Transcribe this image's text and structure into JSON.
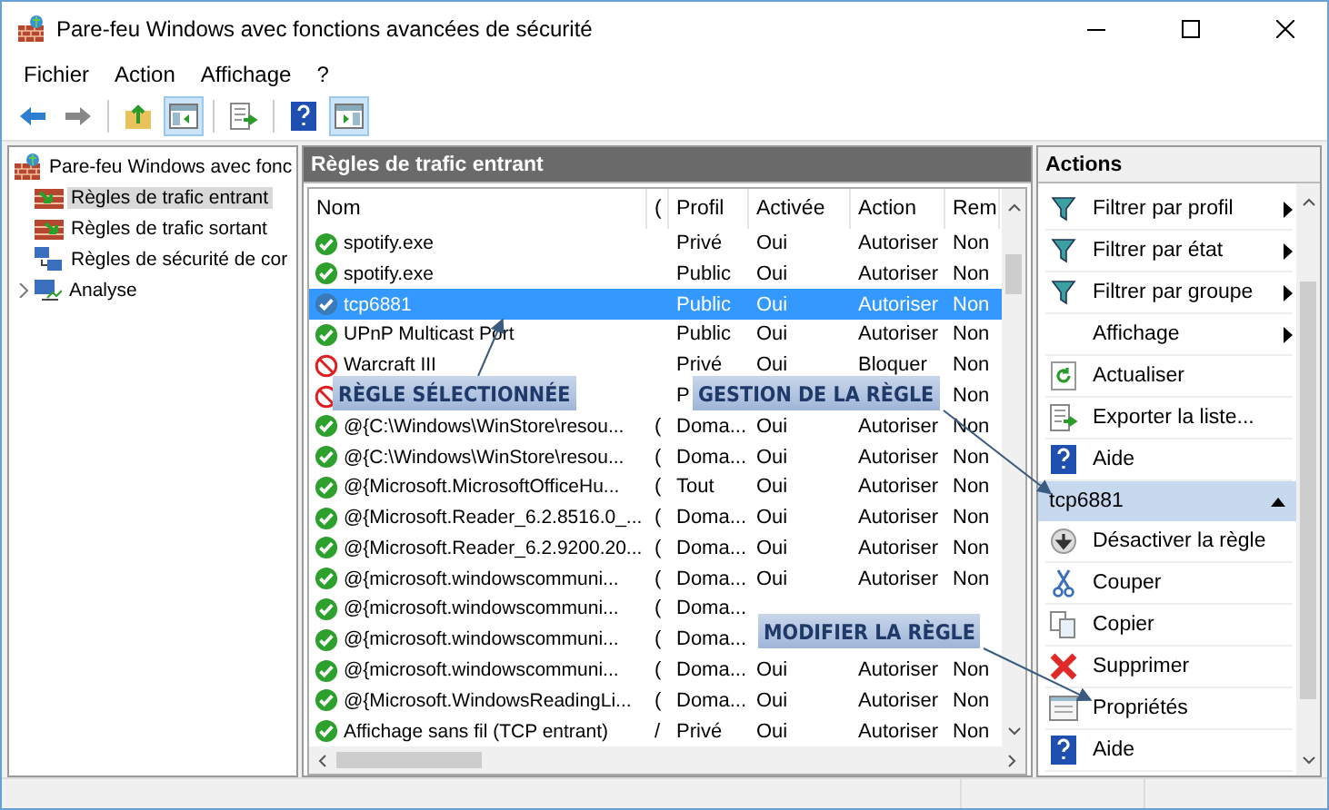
{
  "window": {
    "title": "Pare-feu Windows avec fonctions avancées de sécurité"
  },
  "menu": [
    "Fichier",
    "Action",
    "Affichage",
    "?"
  ],
  "toolbar": [
    {
      "kind": "back",
      "pressed": false
    },
    {
      "kind": "forward",
      "pressed": false
    },
    {
      "kind": "up",
      "pressed": false
    },
    {
      "kind": "tree",
      "pressed": true
    },
    {
      "kind": "export",
      "pressed": false
    },
    {
      "kind": "help",
      "pressed": false
    },
    {
      "kind": "actionpane",
      "pressed": true
    }
  ],
  "tree": {
    "label": "Pare-feu Windows avec fonc",
    "children": [
      {
        "label": "Règles de trafic entrant",
        "kind": "inbound",
        "selected": true
      },
      {
        "label": "Règles de trafic sortant",
        "kind": "outbound",
        "selected": false
      },
      {
        "label": "Règles de sécurité de cor",
        "kind": "security",
        "selected": false
      },
      {
        "label": "Analyse",
        "kind": "monitor",
        "selected": false,
        "expanded": false
      }
    ]
  },
  "table": {
    "title": "Règles de trafic entrant",
    "columns": [
      "Nom",
      "(",
      "Profil",
      "Activée",
      "Action",
      "Rem"
    ],
    "rows": [
      {
        "kind": "allow",
        "selected": false,
        "name": "spotify.exe",
        "profile": "Privé",
        "enabled": "Oui",
        "action": "Autoriser",
        "rem": "Non"
      },
      {
        "kind": "allow",
        "selected": false,
        "name": "spotify.exe",
        "profile": "Public",
        "enabled": "Oui",
        "action": "Autoriser",
        "rem": "Non"
      },
      {
        "kind": "allow",
        "selected": true,
        "name": "tcp6881",
        "profile": "Public",
        "enabled": "Oui",
        "action": "Autoriser",
        "rem": "Non"
      },
      {
        "kind": "allow",
        "selected": false,
        "name": "UPnP Multicast Port",
        "profile": "Public",
        "enabled": "Oui",
        "action": "Autoriser",
        "rem": "Non"
      },
      {
        "kind": "block",
        "selected": false,
        "name": "Warcraft III",
        "profile": "Privé",
        "enabled": "Oui",
        "action": "Bloquer",
        "rem": "Non"
      },
      {
        "kind": "block",
        "selected": false,
        "profile": "P",
        "rem": "Non"
      },
      {
        "kind": "allow",
        "selected": false,
        "name": "@{C:\\Windows\\WinStore\\resou...",
        "col2": "(",
        "profile": "Doma...",
        "enabled": "Oui",
        "action": "Autoriser",
        "rem": "Non"
      },
      {
        "kind": "allow",
        "selected": false,
        "name": "@{C:\\Windows\\WinStore\\resou...",
        "col2": "(",
        "profile": "Doma...",
        "enabled": "Oui",
        "action": "Autoriser",
        "rem": "Non"
      },
      {
        "kind": "allow",
        "selected": false,
        "name": "@{Microsoft.MicrosoftOfficeHu...",
        "col2": "(",
        "profile": "Tout",
        "enabled": "Oui",
        "action": "Autoriser",
        "rem": "Non"
      },
      {
        "kind": "allow",
        "selected": false,
        "name": "@{Microsoft.Reader_6.2.8516.0_...",
        "col2": "(",
        "profile": "Doma...",
        "enabled": "Oui",
        "action": "Autoriser",
        "rem": "Non"
      },
      {
        "kind": "allow",
        "selected": false,
        "name": "@{Microsoft.Reader_6.2.9200.20...",
        "col2": "(",
        "profile": "Doma...",
        "enabled": "Oui",
        "action": "Autoriser",
        "rem": "Non"
      },
      {
        "kind": "allow",
        "selected": false,
        "name": "@{microsoft.windowscommuni...",
        "col2": "(",
        "profile": "Doma...",
        "enabled": "Oui",
        "action": "Autoriser",
        "rem": "Non"
      },
      {
        "kind": "allow",
        "selected": false,
        "name": "@{microsoft.windowscommuni...",
        "col2": "(",
        "profile": "Doma..."
      },
      {
        "kind": "allow",
        "selected": false,
        "name": "@{microsoft.windowscommuni...",
        "col2": "(",
        "profile": "Doma..."
      },
      {
        "kind": "allow",
        "selected": false,
        "name": "@{microsoft.windowscommuni...",
        "col2": "(",
        "profile": "Doma...",
        "enabled": "Oui",
        "action": "Autoriser",
        "rem": "Non"
      },
      {
        "kind": "allow",
        "selected": false,
        "name": "@{Microsoft.WindowsReadingLi...",
        "col2": "(",
        "profile": "Doma...",
        "enabled": "Oui",
        "action": "Autoriser",
        "rem": "Non"
      },
      {
        "kind": "allow",
        "selected": false,
        "name": "Affichage sans fil (TCP entrant)",
        "col2": "/",
        "profile": "Privé",
        "enabled": "Oui",
        "action": "Autoriser",
        "rem": "Non"
      }
    ]
  },
  "actions": {
    "title": "Actions",
    "items": [
      {
        "kind": "filter",
        "label": "Filtrer par profil",
        "submenu": true
      },
      {
        "kind": "filter",
        "label": "Filtrer par état",
        "submenu": true
      },
      {
        "kind": "filter",
        "label": "Filtrer par groupe",
        "submenu": true
      },
      {
        "kind": "none",
        "label": "Affichage",
        "submenu": true
      },
      {
        "kind": "refresh",
        "label": "Actualiser",
        "submenu": false
      },
      {
        "kind": "export",
        "label": "Exporter la liste...",
        "submenu": false
      },
      {
        "kind": "help",
        "label": "Aide",
        "submenu": false
      }
    ],
    "section": {
      "title": "tcp6881",
      "expanded": true
    },
    "section_items": [
      {
        "kind": "disable",
        "label": "Désactiver la règle"
      },
      {
        "kind": "cut",
        "label": "Couper"
      },
      {
        "kind": "copy",
        "label": "Copier"
      },
      {
        "kind": "delete",
        "label": "Supprimer"
      },
      {
        "kind": "properties",
        "label": "Propriétés"
      },
      {
        "kind": "help",
        "label": "Aide"
      }
    ]
  },
  "annotations": [
    "RÈGLE SÉLECTIONNÉE",
    "GESTION DE LA RÈGLE",
    "MODIFIER LA RÈGLE"
  ]
}
